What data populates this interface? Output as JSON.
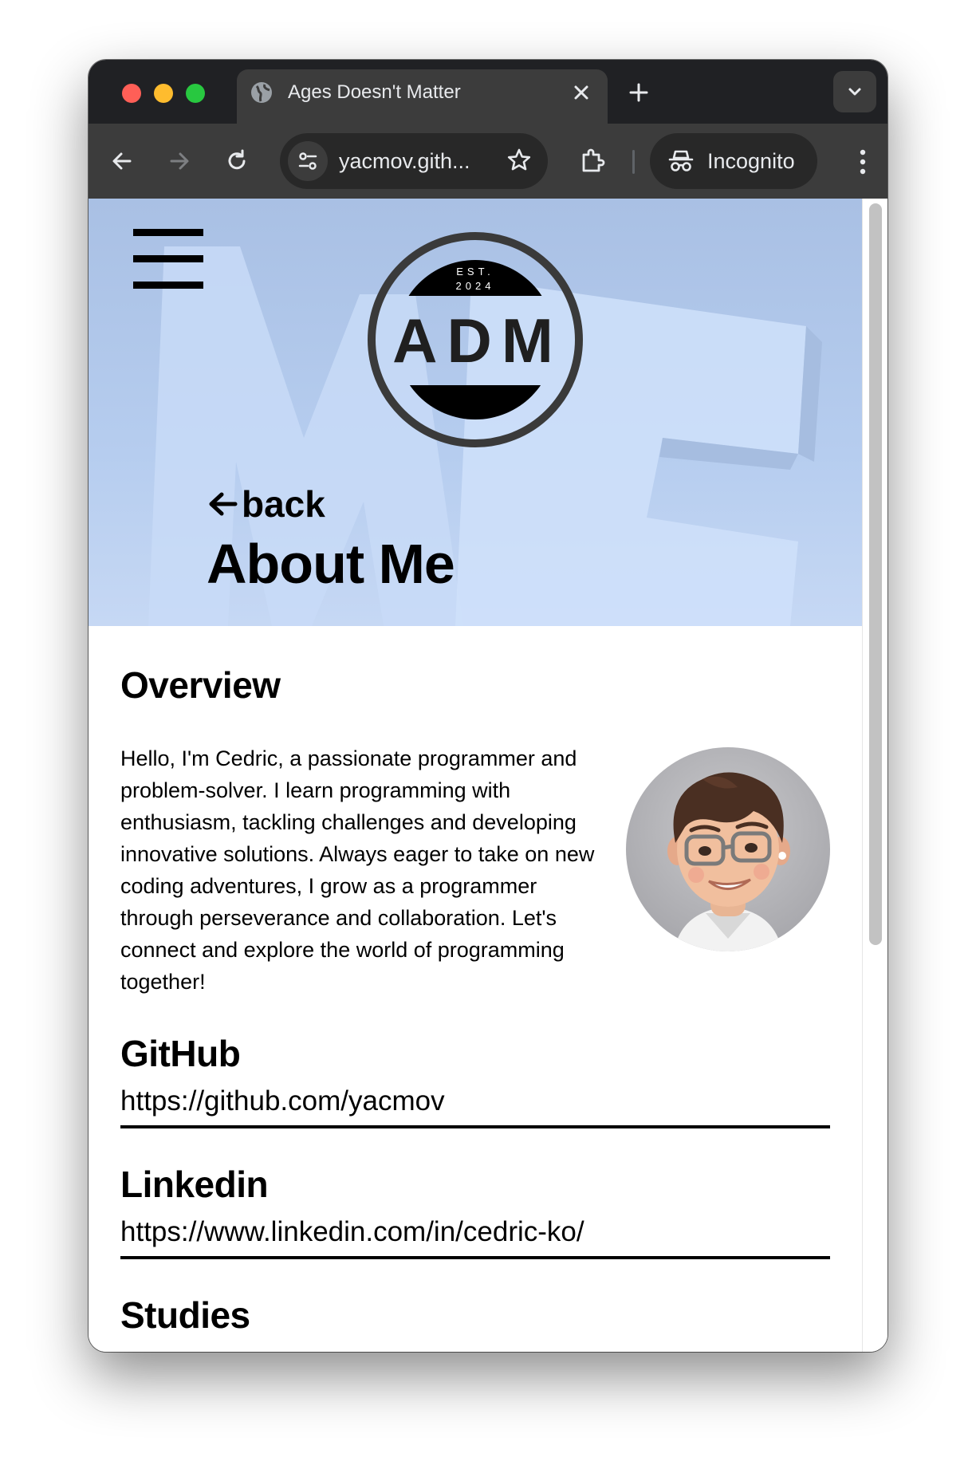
{
  "browser": {
    "tab_title": "Ages Doesn't Matter",
    "url": "yacmov.gith...",
    "incognito_label": "Incognito"
  },
  "page": {
    "logo": {
      "est": "EST.",
      "year": "2024",
      "mark": "ADM"
    },
    "hero_background_text": "ME",
    "back_label": "back",
    "title": "About Me",
    "overview": {
      "heading": "Overview",
      "text": "Hello, I'm Cedric, a passionate programmer and problem-solver. I learn programming with enthusiasm, tackling challenges and developing innovative solutions. Always eager to take on new coding adventures, I grow as a programmer through perseverance and collaboration. Let's connect and explore the world of programming together!"
    },
    "github": {
      "heading": "GitHub",
      "url": "https://github.com/yacmov"
    },
    "linkedin": {
      "heading": "Linkedin",
      "url": "https://www.linkedin.com/in/cedric-ko/"
    },
    "studies": {
      "heading": "Studies"
    }
  },
  "colors": {
    "hero_bg": "#b6cdef",
    "chrome_dark": "#202124",
    "toolbar": "#3c3c3c",
    "text": "#000000"
  },
  "icons": [
    "globe-icon",
    "close-icon",
    "plus-icon",
    "chevron-down-icon",
    "back-arrow-icon",
    "forward-arrow-icon",
    "reload-icon",
    "tune-icon",
    "star-icon",
    "extension-icon",
    "incognito-icon",
    "more-vert-icon",
    "hamburger-menu-icon",
    "arrow-left-icon"
  ]
}
